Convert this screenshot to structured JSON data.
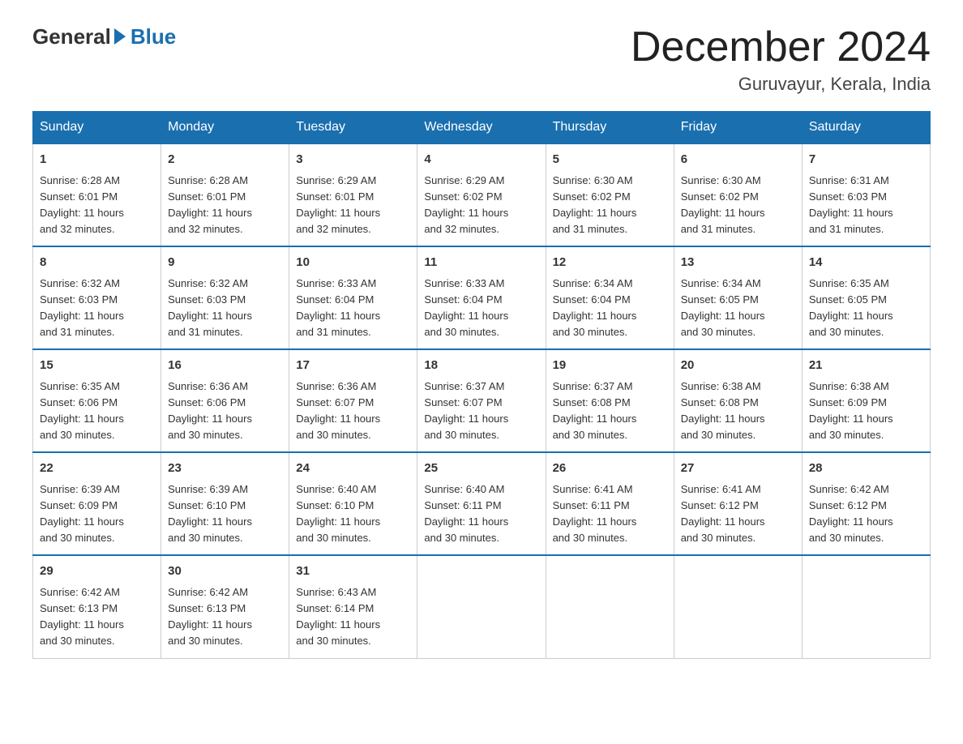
{
  "header": {
    "logo_general": "General",
    "logo_blue": "Blue",
    "title": "December 2024",
    "subtitle": "Guruvayur, Kerala, India"
  },
  "columns": [
    "Sunday",
    "Monday",
    "Tuesday",
    "Wednesday",
    "Thursday",
    "Friday",
    "Saturday"
  ],
  "weeks": [
    [
      {
        "day": "1",
        "sunrise": "6:28 AM",
        "sunset": "6:01 PM",
        "daylight": "11 hours and 32 minutes."
      },
      {
        "day": "2",
        "sunrise": "6:28 AM",
        "sunset": "6:01 PM",
        "daylight": "11 hours and 32 minutes."
      },
      {
        "day": "3",
        "sunrise": "6:29 AM",
        "sunset": "6:01 PM",
        "daylight": "11 hours and 32 minutes."
      },
      {
        "day": "4",
        "sunrise": "6:29 AM",
        "sunset": "6:02 PM",
        "daylight": "11 hours and 32 minutes."
      },
      {
        "day": "5",
        "sunrise": "6:30 AM",
        "sunset": "6:02 PM",
        "daylight": "11 hours and 31 minutes."
      },
      {
        "day": "6",
        "sunrise": "6:30 AM",
        "sunset": "6:02 PM",
        "daylight": "11 hours and 31 minutes."
      },
      {
        "day": "7",
        "sunrise": "6:31 AM",
        "sunset": "6:03 PM",
        "daylight": "11 hours and 31 minutes."
      }
    ],
    [
      {
        "day": "8",
        "sunrise": "6:32 AM",
        "sunset": "6:03 PM",
        "daylight": "11 hours and 31 minutes."
      },
      {
        "day": "9",
        "sunrise": "6:32 AM",
        "sunset": "6:03 PM",
        "daylight": "11 hours and 31 minutes."
      },
      {
        "day": "10",
        "sunrise": "6:33 AM",
        "sunset": "6:04 PM",
        "daylight": "11 hours and 31 minutes."
      },
      {
        "day": "11",
        "sunrise": "6:33 AM",
        "sunset": "6:04 PM",
        "daylight": "11 hours and 30 minutes."
      },
      {
        "day": "12",
        "sunrise": "6:34 AM",
        "sunset": "6:04 PM",
        "daylight": "11 hours and 30 minutes."
      },
      {
        "day": "13",
        "sunrise": "6:34 AM",
        "sunset": "6:05 PM",
        "daylight": "11 hours and 30 minutes."
      },
      {
        "day": "14",
        "sunrise": "6:35 AM",
        "sunset": "6:05 PM",
        "daylight": "11 hours and 30 minutes."
      }
    ],
    [
      {
        "day": "15",
        "sunrise": "6:35 AM",
        "sunset": "6:06 PM",
        "daylight": "11 hours and 30 minutes."
      },
      {
        "day": "16",
        "sunrise": "6:36 AM",
        "sunset": "6:06 PM",
        "daylight": "11 hours and 30 minutes."
      },
      {
        "day": "17",
        "sunrise": "6:36 AM",
        "sunset": "6:07 PM",
        "daylight": "11 hours and 30 minutes."
      },
      {
        "day": "18",
        "sunrise": "6:37 AM",
        "sunset": "6:07 PM",
        "daylight": "11 hours and 30 minutes."
      },
      {
        "day": "19",
        "sunrise": "6:37 AM",
        "sunset": "6:08 PM",
        "daylight": "11 hours and 30 minutes."
      },
      {
        "day": "20",
        "sunrise": "6:38 AM",
        "sunset": "6:08 PM",
        "daylight": "11 hours and 30 minutes."
      },
      {
        "day": "21",
        "sunrise": "6:38 AM",
        "sunset": "6:09 PM",
        "daylight": "11 hours and 30 minutes."
      }
    ],
    [
      {
        "day": "22",
        "sunrise": "6:39 AM",
        "sunset": "6:09 PM",
        "daylight": "11 hours and 30 minutes."
      },
      {
        "day": "23",
        "sunrise": "6:39 AM",
        "sunset": "6:10 PM",
        "daylight": "11 hours and 30 minutes."
      },
      {
        "day": "24",
        "sunrise": "6:40 AM",
        "sunset": "6:10 PM",
        "daylight": "11 hours and 30 minutes."
      },
      {
        "day": "25",
        "sunrise": "6:40 AM",
        "sunset": "6:11 PM",
        "daylight": "11 hours and 30 minutes."
      },
      {
        "day": "26",
        "sunrise": "6:41 AM",
        "sunset": "6:11 PM",
        "daylight": "11 hours and 30 minutes."
      },
      {
        "day": "27",
        "sunrise": "6:41 AM",
        "sunset": "6:12 PM",
        "daylight": "11 hours and 30 minutes."
      },
      {
        "day": "28",
        "sunrise": "6:42 AM",
        "sunset": "6:12 PM",
        "daylight": "11 hours and 30 minutes."
      }
    ],
    [
      {
        "day": "29",
        "sunrise": "6:42 AM",
        "sunset": "6:13 PM",
        "daylight": "11 hours and 30 minutes."
      },
      {
        "day": "30",
        "sunrise": "6:42 AM",
        "sunset": "6:13 PM",
        "daylight": "11 hours and 30 minutes."
      },
      {
        "day": "31",
        "sunrise": "6:43 AM",
        "sunset": "6:14 PM",
        "daylight": "11 hours and 30 minutes."
      },
      null,
      null,
      null,
      null
    ]
  ],
  "labels": {
    "sunrise": "Sunrise:",
    "sunset": "Sunset:",
    "daylight": "Daylight:"
  }
}
